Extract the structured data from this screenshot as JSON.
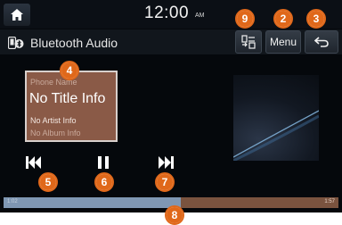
{
  "status_bar": {
    "time": "12:00",
    "ampm": "AM"
  },
  "header": {
    "source_title": "Bluetooth Audio",
    "menu_label": "Menu"
  },
  "track": {
    "phone_name": "Phone Name",
    "title": "No Title Info",
    "artist": "No Artist Info",
    "album": "No Album Info"
  },
  "progress": {
    "elapsed": "1:02",
    "total": "1:57",
    "fraction": 0.53
  },
  "callouts": {
    "list": "9",
    "menu": "2",
    "back": "3",
    "info": "4",
    "prev": "5",
    "pause": "6",
    "next": "7",
    "progress": "8"
  },
  "icons": {
    "home": "home-icon",
    "bluetooth": "bluetooth-phone-icon",
    "list": "playlist-icon",
    "back": "back-arrow-icon",
    "prev": "skip-previous-icon",
    "pause": "pause-icon",
    "next": "skip-next-icon"
  },
  "colors": {
    "callout": "#e0681a",
    "card": "#8a5a47",
    "progress_played": "#7f97b3",
    "progress_remaining": "#7a533f"
  }
}
